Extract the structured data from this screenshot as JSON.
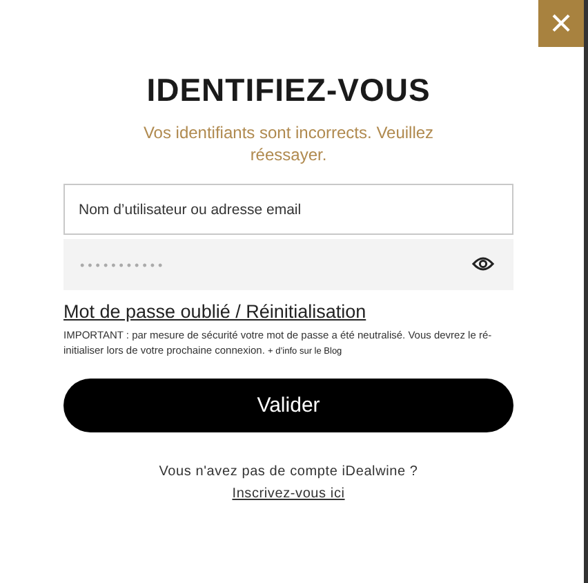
{
  "close_button": {
    "label": "×"
  },
  "title": "IDENTIFIEZ-VOUS",
  "error_message": "Vos identifiants sont incorrects. Veuillez réessayer.",
  "username_field": {
    "placeholder": "Nom d’utilisateur ou adresse email"
  },
  "password_field": {
    "placeholder": "• • • • • • • • • • •"
  },
  "forgot_link": "Mot de passe oublié / Réinitialisation",
  "notice": {
    "text": "IMPORTANT : par mesure de sécurité votre mot de passe a été neutralisé. Vous devrez le ré-initialiser lors de votre prochaine connexion.",
    "link": "+ d’info sur le Blog"
  },
  "submit_button": "Valider",
  "signup_prompt": "Vous n'avez pas de compte iDealwine ?",
  "signup_link": "Inscrivez-vous ici"
}
